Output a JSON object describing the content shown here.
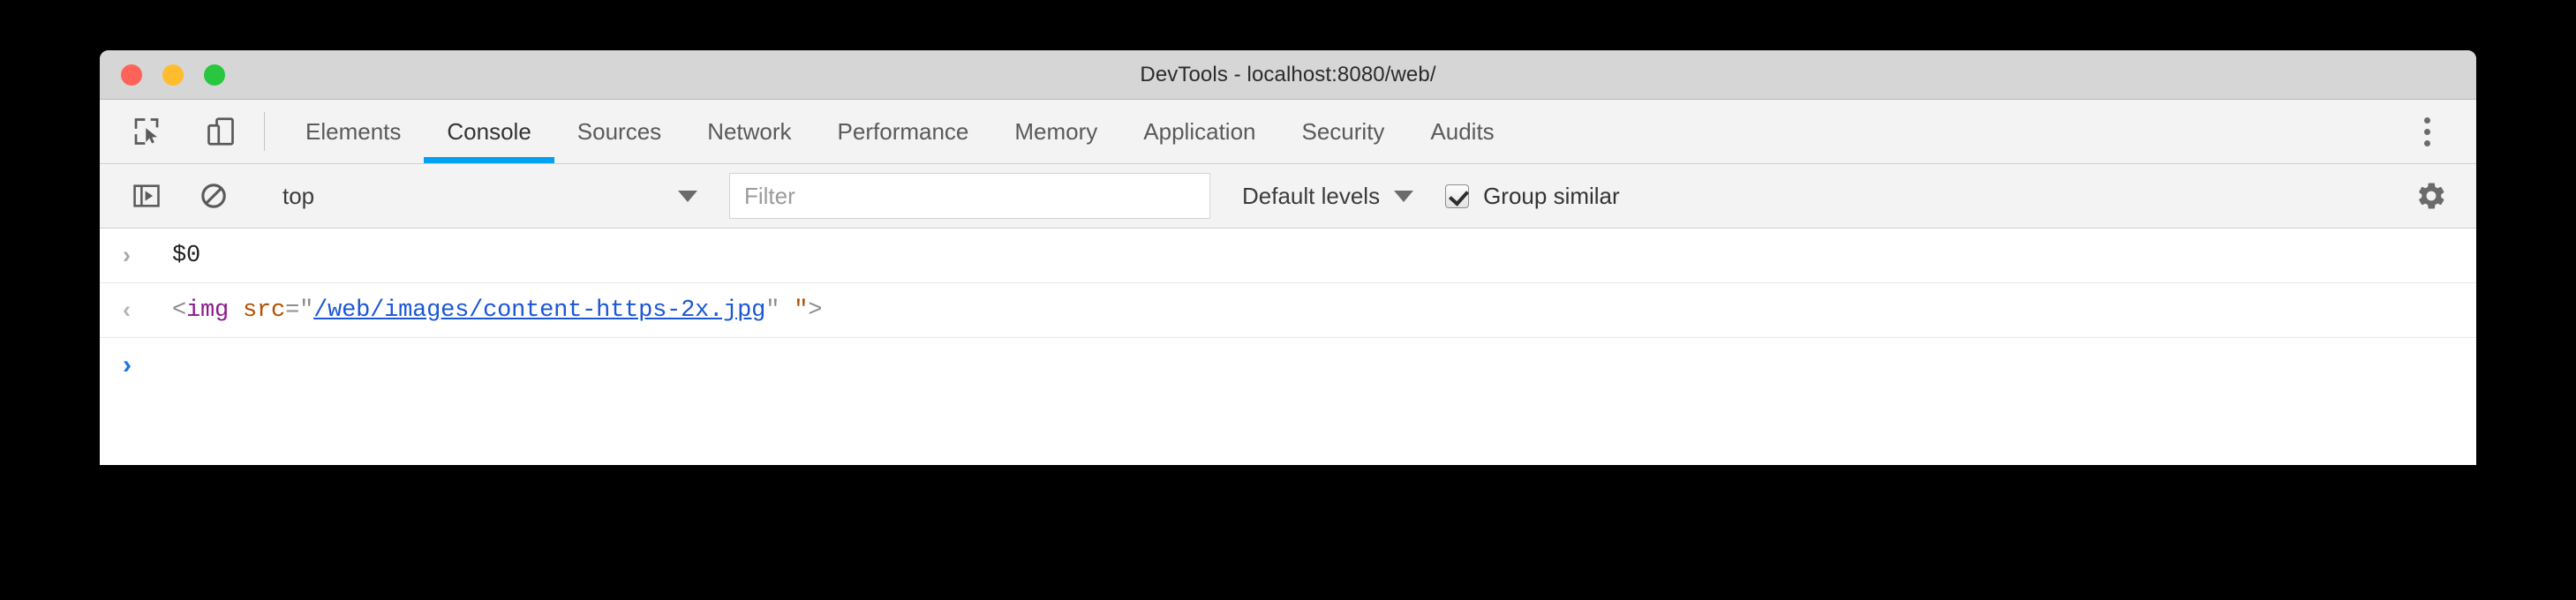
{
  "window": {
    "title": "DevTools - localhost:8080/web/",
    "traffic_lights": [
      {
        "name": "close",
        "color": "#ff6259"
      },
      {
        "name": "minimize",
        "color": "#ffbc2e"
      },
      {
        "name": "zoom",
        "color": "#29c73f"
      }
    ]
  },
  "toolbar_icons": {
    "inspect_element": "inspect-element-icon",
    "device_toolbar": "device-toolbar-icon",
    "more_tools": "kebab-menu-icon"
  },
  "tabs": [
    {
      "label": "Elements",
      "active": false
    },
    {
      "label": "Console",
      "active": true
    },
    {
      "label": "Sources",
      "active": false
    },
    {
      "label": "Network",
      "active": false
    },
    {
      "label": "Performance",
      "active": false
    },
    {
      "label": "Memory",
      "active": false
    },
    {
      "label": "Application",
      "active": false
    },
    {
      "label": "Security",
      "active": false
    },
    {
      "label": "Audits",
      "active": false
    }
  ],
  "filterbar": {
    "sidebar_toggle_icon": "console-sidebar-toggle-icon",
    "clear_console_icon": "clear-console-icon",
    "context": "top",
    "context_options": [
      "top"
    ],
    "filter_placeholder": "Filter",
    "filter_value": "",
    "levels": "Default levels",
    "levels_options": [
      "Default levels"
    ],
    "group_similar_label": "Group similar",
    "group_similar_checked": true,
    "settings_icon": "gear-icon"
  },
  "console": {
    "rows": [
      {
        "kind": "input",
        "gutter": "›",
        "text": "$0"
      },
      {
        "kind": "result",
        "gutter": "‹",
        "tokens": {
          "open": "<",
          "tag": "img",
          "space": " ",
          "attr": "src",
          "eq": "=",
          "q1": "\"",
          "link": "/web/images/content-https-2x.jpg",
          "q2": "\"",
          "trail": " \"",
          "close": ">"
        }
      },
      {
        "kind": "prompt",
        "gutter": "›",
        "text": ""
      }
    ]
  },
  "colors": {
    "accent": "#00a2ef",
    "titlebar": "#d6d6d6",
    "toolbar": "#f3f3f3",
    "console_bg": "#ffffff",
    "tag": "#8b1a8b",
    "attr": "#b35000",
    "link": "#1a56d6",
    "prompt": "#1a73e8"
  }
}
